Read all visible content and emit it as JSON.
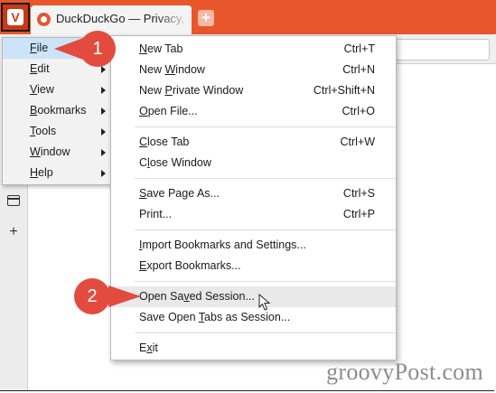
{
  "browser": {
    "tab": {
      "title": "DuckDuckGo — Privacy, sin"
    }
  },
  "main_menu": {
    "items": [
      {
        "label": "File",
        "mnemonic": "F",
        "rest": "ile",
        "active": true
      },
      {
        "label": "Edit",
        "mnemonic": "E",
        "rest": "dit"
      },
      {
        "label": "View",
        "mnemonic": "V",
        "rest": "iew"
      },
      {
        "label": "Bookmarks",
        "mnemonic": "B",
        "rest": "ookmarks"
      },
      {
        "label": "Tools",
        "mnemonic": "T",
        "rest": "ools"
      },
      {
        "label": "Window",
        "mnemonic": "W",
        "rest": "indow"
      },
      {
        "label": "Help",
        "mnemonic": "H",
        "rest": "elp"
      }
    ]
  },
  "file_menu": {
    "new_tab": {
      "pre": "",
      "u": "N",
      "post": "ew Tab",
      "shortcut": "Ctrl+T"
    },
    "new_window": {
      "pre": "New ",
      "u": "W",
      "post": "indow",
      "shortcut": "Ctrl+N"
    },
    "new_private_window": {
      "pre": "New ",
      "u": "P",
      "post": "rivate Window",
      "shortcut": "Ctrl+Shift+N"
    },
    "open_file": {
      "pre": "",
      "u": "O",
      "post": "pen File...",
      "shortcut": "Ctrl+O"
    },
    "close_tab": {
      "pre": "",
      "u": "C",
      "post": "lose Tab",
      "shortcut": "Ctrl+W"
    },
    "close_window": {
      "pre": "C",
      "u": "l",
      "post": "ose Window",
      "shortcut": ""
    },
    "save_page_as": {
      "pre": "",
      "u": "S",
      "post": "ave Page As...",
      "shortcut": "Ctrl+S"
    },
    "print": {
      "pre": "Print...",
      "u": "",
      "post": "",
      "shortcut": "Ctrl+P"
    },
    "import_bookmarks": {
      "pre": "",
      "u": "I",
      "post": "mport Bookmarks and Settings...",
      "shortcut": ""
    },
    "export_bookmarks": {
      "pre": "",
      "u": "E",
      "post": "xport Bookmarks...",
      "shortcut": ""
    },
    "open_saved_session": {
      "pre": "Open Sa",
      "u": "v",
      "post": "ed Session...",
      "shortcut": ""
    },
    "save_open_tabs": {
      "pre": "Save Open ",
      "u": "T",
      "post": "abs as Session...",
      "shortcut": ""
    },
    "exit": {
      "pre": "E",
      "u": "x",
      "post": "it",
      "shortcut": ""
    }
  },
  "callouts": {
    "one": "1",
    "two": "2"
  },
  "watermark": "groovyPost.com",
  "colors": {
    "accent": "#e8562b",
    "callout": "#e34b3e",
    "active_item": "#cce4f7",
    "hover_item": "#e9e9e9"
  },
  "icons": [
    "vivaldi-menu-icon",
    "duckduckgo-favicon",
    "new-tab-plus-icon",
    "window-panel-icon",
    "add-panel-icon",
    "mouse-cursor-icon"
  ]
}
